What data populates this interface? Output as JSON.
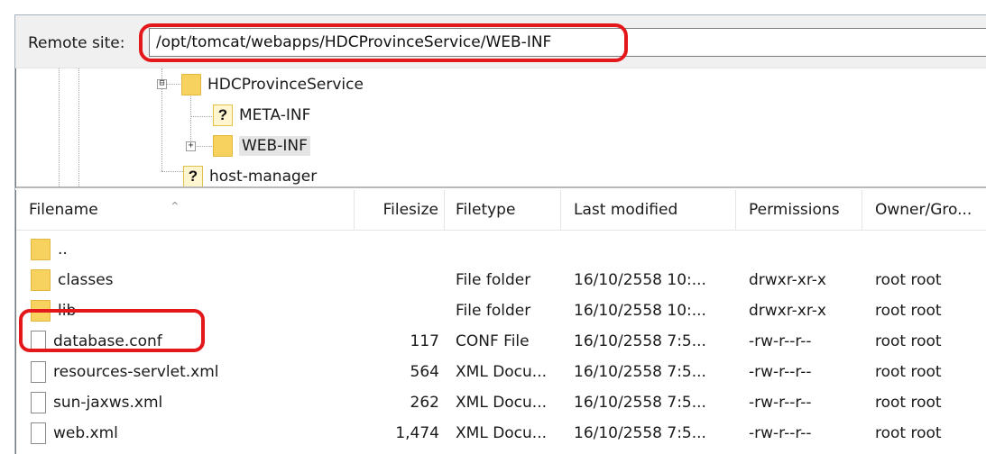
{
  "remote_site": {
    "label": "Remote site:",
    "path": "/opt/tomcat/webapps/HDCProvinceService/WEB-INF"
  },
  "tree": [
    {
      "label": "HDCProvinceService",
      "icon": "folder-icon",
      "expander": "⊟"
    },
    {
      "label": "META-INF",
      "icon": "unknown-folder-icon"
    },
    {
      "label": "WEB-INF",
      "icon": "folder-icon",
      "expander": "+",
      "selected": true
    },
    {
      "label": "host-manager",
      "icon": "unknown-folder-icon"
    }
  ],
  "file_list": {
    "columns": [
      "Filename",
      "Filesize",
      "Filetype",
      "Last modified",
      "Permissions",
      "Owner/Gro..."
    ],
    "rows": [
      {
        "name": "..",
        "size": "",
        "type": "",
        "modified": "",
        "permissions": "",
        "owner": "",
        "icon": "folder-icon"
      },
      {
        "name": "classes",
        "size": "",
        "type": "File folder",
        "modified": "16/10/2558 10:...",
        "permissions": "drwxr-xr-x",
        "owner": "root root",
        "icon": "folder-icon"
      },
      {
        "name": "lib",
        "size": "",
        "type": "File folder",
        "modified": "16/10/2558 10:...",
        "permissions": "drwxr-xr-x",
        "owner": "root root",
        "icon": "folder-icon"
      },
      {
        "name": "database.conf",
        "size": "117",
        "type": "CONF File",
        "modified": "16/10/2558 7:5...",
        "permissions": "-rw-r--r--",
        "owner": "root root",
        "icon": "file-icon"
      },
      {
        "name": "resources-servlet.xml",
        "size": "564",
        "type": "XML Docu...",
        "modified": "16/10/2558 7:5...",
        "permissions": "-rw-r--r--",
        "owner": "root root",
        "icon": "file-icon"
      },
      {
        "name": "sun-jaxws.xml",
        "size": "262",
        "type": "XML Docu...",
        "modified": "16/10/2558 7:5...",
        "permissions": "-rw-r--r--",
        "owner": "root root",
        "icon": "file-icon"
      },
      {
        "name": "web.xml",
        "size": "1,474",
        "type": "XML Docu...",
        "modified": "16/10/2558 7:5...",
        "permissions": "-rw-r--r--",
        "owner": "root root",
        "icon": "file-icon"
      }
    ]
  },
  "annotation_color": "#e4171b"
}
